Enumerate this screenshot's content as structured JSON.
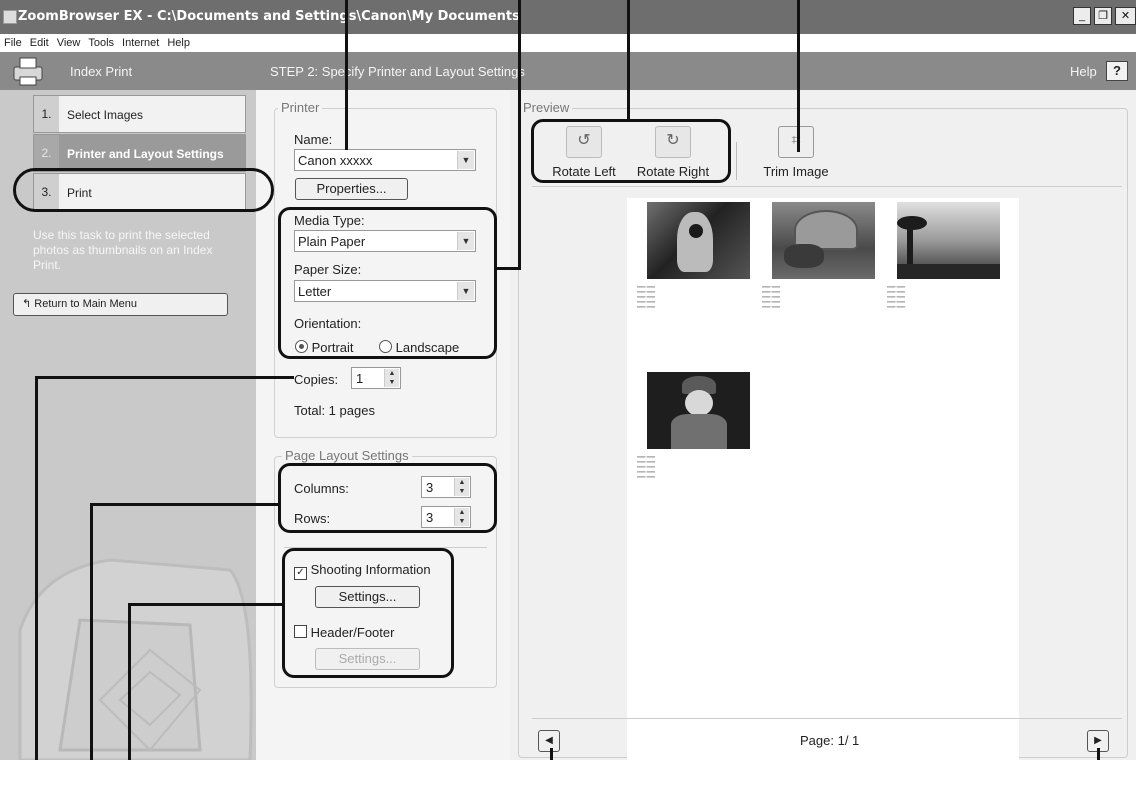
{
  "window": {
    "title": "ZoomBrowser EX  -  C:\\Documents and Settings\\Canon\\My Documents",
    "icons": [
      "app-icon",
      "minimize-icon",
      "restore-icon",
      "close-icon"
    ]
  },
  "menu": [
    "File",
    "Edit",
    "View",
    "Tools",
    "Internet",
    "Help"
  ],
  "header": {
    "task": "Index Print",
    "step_title": "STEP 2: Specify Printer and Layout Settings",
    "help": "Help",
    "help_icon": "?"
  },
  "steps": [
    {
      "num": "1.",
      "label": "Select Images"
    },
    {
      "num": "2.",
      "label": "Printer and Layout Settings"
    },
    {
      "num": "3.",
      "label": "Print"
    }
  ],
  "sidebar": {
    "description": "Use this task to print the selected photos as thumbnails on an Index Print.",
    "return_label": "Return to Main Menu"
  },
  "printer": {
    "legend": "Printer",
    "name_label": "Name:",
    "name_value": "Canon xxxxx",
    "properties_label": "Properties...",
    "media_type_label": "Media Type:",
    "media_type_value": "Plain Paper",
    "paper_size_label": "Paper Size:",
    "paper_size_value": "Letter",
    "orientation_label": "Orientation:",
    "portrait_label": "Portrait",
    "landscape_label": "Landscape",
    "orientation_selected": "Portrait",
    "copies_label": "Copies:",
    "copies_value": "1",
    "total_label": "Total: 1 pages"
  },
  "layout": {
    "legend": "Page Layout Settings",
    "columns_label": "Columns:",
    "columns_value": "3",
    "rows_label": "Rows:",
    "rows_value": "3",
    "shooting_info_label": "Shooting Information",
    "shooting_info_checked": true,
    "settings_label": "Settings...",
    "header_footer_label": "Header/Footer",
    "header_footer_checked": false,
    "settings2_label": "Settings..."
  },
  "preview": {
    "legend": "Preview",
    "rotate_left": "Rotate Left",
    "rotate_right": "Rotate Right",
    "trim": "Trim Image",
    "page_label": "Page: 1/ 1",
    "thumbnails": [
      {
        "subject": "parrot",
        "tone": "#3a3a3a"
      },
      {
        "subject": "tortoise",
        "tone": "#555555"
      },
      {
        "subject": "palm sunset",
        "tone": "#4a4a4a"
      },
      {
        "subject": "child",
        "tone": "#2e2e2e"
      }
    ]
  },
  "colors": {
    "titlebar": "#6e6e6e",
    "header": "#8a8a8a",
    "sidebar": "#c9c9c9",
    "callout": "#111111"
  }
}
